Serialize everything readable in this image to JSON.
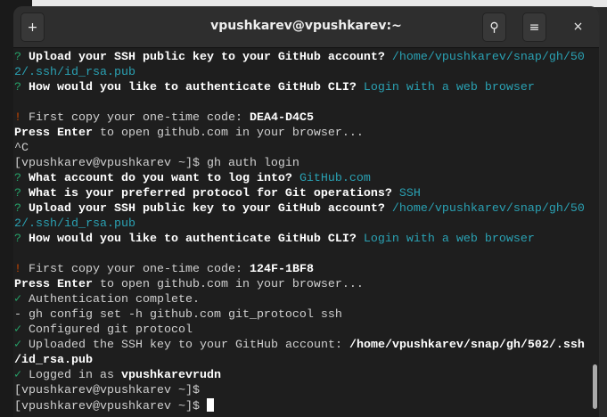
{
  "window": {
    "title": "vpushkarev@vpushkarev:~"
  },
  "header": {
    "new_tab_icon": "+",
    "search_icon": "⚲",
    "menu_icon": "≡",
    "close_icon": "×"
  },
  "terminal": {
    "lines": [
      [
        {
          "t": "? ",
          "s": "g"
        },
        {
          "t": "Upload your SSH public key to your GitHub account? ",
          "s": "b"
        },
        {
          "t": "/home/vpushkarev/snap/gh/50",
          "s": "c"
        }
      ],
      [
        {
          "t": "2/.ssh/id_rsa.pub",
          "s": "c"
        }
      ],
      [
        {
          "t": "? ",
          "s": "g"
        },
        {
          "t": "How would you like to authenticate GitHub CLI? ",
          "s": "b"
        },
        {
          "t": "Login with a web browser",
          "s": "c"
        }
      ],
      [],
      [
        {
          "t": "! ",
          "s": "o"
        },
        {
          "t": "First copy your one-time code: ",
          "s": ""
        },
        {
          "t": "DEA4-D4C5",
          "s": "b"
        }
      ],
      [
        {
          "t": "Press Enter",
          "s": "b"
        },
        {
          "t": " to open github.com in your browser...",
          "s": ""
        }
      ],
      [
        {
          "t": "^C",
          "s": ""
        }
      ],
      [
        {
          "t": "[vpushkarev@vpushkarev ~]$ gh auth login",
          "s": ""
        }
      ],
      [
        {
          "t": "? ",
          "s": "g"
        },
        {
          "t": "What account do you want to log into? ",
          "s": "b"
        },
        {
          "t": "GitHub.com",
          "s": "c"
        }
      ],
      [
        {
          "t": "? ",
          "s": "g"
        },
        {
          "t": "What is your preferred protocol for Git operations? ",
          "s": "b"
        },
        {
          "t": "SSH",
          "s": "c"
        }
      ],
      [
        {
          "t": "? ",
          "s": "g"
        },
        {
          "t": "Upload your SSH public key to your GitHub account? ",
          "s": "b"
        },
        {
          "t": "/home/vpushkarev/snap/gh/50",
          "s": "c"
        }
      ],
      [
        {
          "t": "2/.ssh/id_rsa.pub",
          "s": "c"
        }
      ],
      [
        {
          "t": "? ",
          "s": "g"
        },
        {
          "t": "How would you like to authenticate GitHub CLI? ",
          "s": "b"
        },
        {
          "t": "Login with a web browser",
          "s": "c"
        }
      ],
      [],
      [
        {
          "t": "! ",
          "s": "o"
        },
        {
          "t": "First copy your one-time code: ",
          "s": ""
        },
        {
          "t": "124F-1BF8",
          "s": "b"
        }
      ],
      [
        {
          "t": "Press Enter",
          "s": "b"
        },
        {
          "t": " to open github.com in your browser...",
          "s": ""
        }
      ],
      [
        {
          "t": "✓ ",
          "s": "g"
        },
        {
          "t": "Authentication complete.",
          "s": ""
        }
      ],
      [
        {
          "t": "- gh config set -h github.com git_protocol ssh",
          "s": ""
        }
      ],
      [
        {
          "t": "✓ ",
          "s": "g"
        },
        {
          "t": "Configured git protocol",
          "s": ""
        }
      ],
      [
        {
          "t": "✓ ",
          "s": "g"
        },
        {
          "t": "Uploaded the SSH key to your GitHub account: ",
          "s": ""
        },
        {
          "t": "/home/vpushkarev/snap/gh/502/.ssh",
          "s": "b"
        }
      ],
      [
        {
          "t": "/id_rsa.pub",
          "s": "b"
        }
      ],
      [
        {
          "t": "✓ ",
          "s": "g"
        },
        {
          "t": "Logged in as ",
          "s": ""
        },
        {
          "t": "vpushkarevrudn",
          "s": "b"
        }
      ],
      [
        {
          "t": "[vpushkarev@vpushkarev ~]$",
          "s": ""
        }
      ],
      [
        {
          "t": "[vpushkarev@vpushkarev ~]$ ",
          "s": ""
        }
      ]
    ]
  }
}
